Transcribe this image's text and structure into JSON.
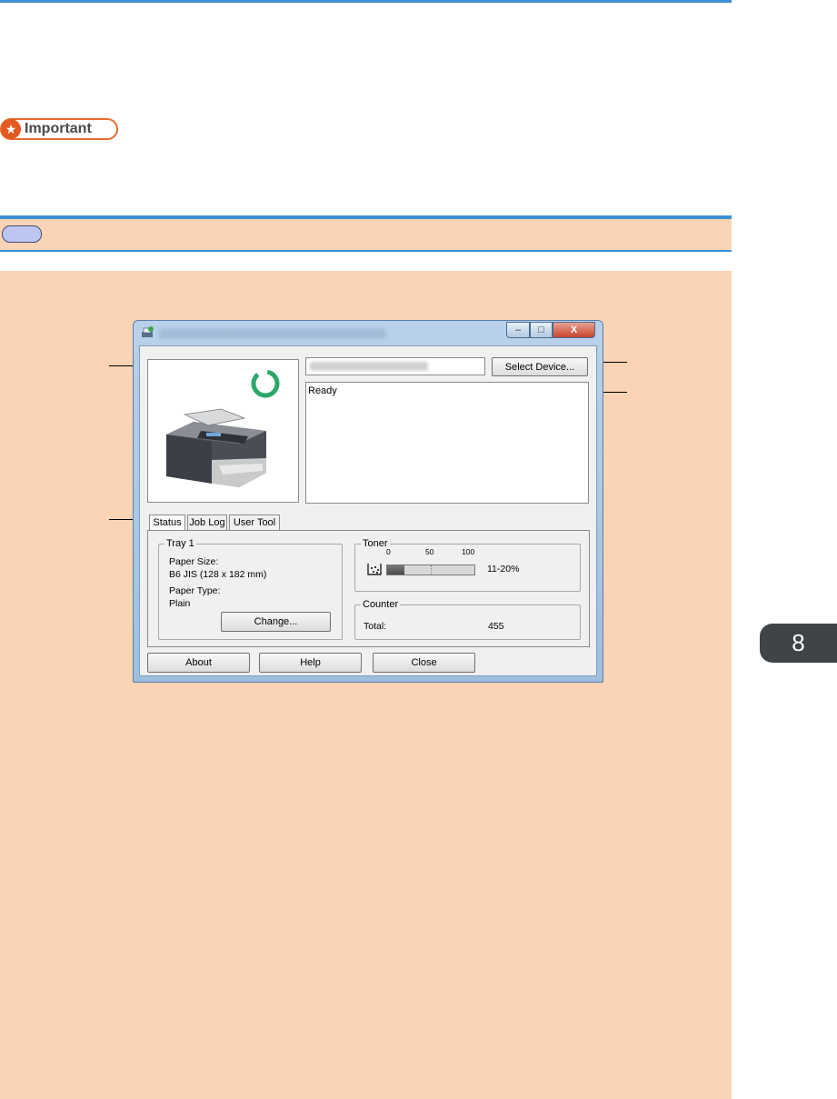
{
  "page": {
    "important_label": "Important",
    "important_icon": "star-icon",
    "note_icon": "note-pill-icon",
    "chapter_tab": "8",
    "accent_color": "#3f8fd2",
    "panel_color": "#fad4b4"
  },
  "window": {
    "title_icon": "printer-status-icon",
    "minimize_glyph": "–",
    "maximize_glyph": "□",
    "close_glyph": "X",
    "select_device_label": "Select Device...",
    "status_text": "Ready",
    "tabs": [
      "Status",
      "Job Log",
      "User Tool"
    ],
    "tray": {
      "legend": "Tray 1",
      "paper_size_label": "Paper Size:",
      "paper_size_value": "B6 JIS (128 x 182 mm)",
      "paper_type_label": "Paper Type:",
      "paper_type_value": "Plain",
      "change_label": "Change..."
    },
    "toner": {
      "legend": "Toner",
      "scale": [
        "0",
        "50",
        "100"
      ],
      "level_text": "11-20%",
      "level_fraction": 0.2
    },
    "counter": {
      "legend": "Counter",
      "total_label": "Total:",
      "total_value": "455"
    },
    "buttons": {
      "about": "About",
      "help": "Help",
      "close": "Close"
    }
  }
}
